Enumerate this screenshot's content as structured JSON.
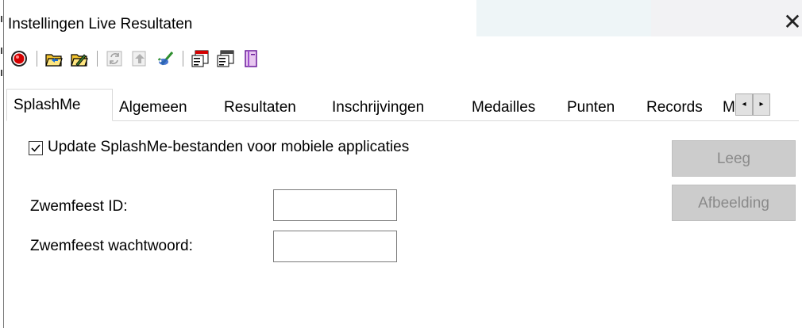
{
  "window": {
    "title": "Instellingen Live Resultaten",
    "close_glyph": "✕"
  },
  "toolbar": {
    "buttons": [
      {
        "icon": "record-icon"
      },
      {
        "icon": "open-folder-icon"
      },
      {
        "icon": "edit-folder-icon"
      },
      {
        "icon": "refresh-icon",
        "disabled": true
      },
      {
        "icon": "upload-icon",
        "disabled": true
      },
      {
        "icon": "check-connect-icon"
      },
      {
        "icon": "properties-red-icon"
      },
      {
        "icon": "properties-icon"
      },
      {
        "icon": "book-icon"
      }
    ]
  },
  "tabs": [
    {
      "label": "SplashMe",
      "selected": true
    },
    {
      "label": "Algemeen"
    },
    {
      "label": "Resultaten"
    },
    {
      "label": "Inschrijvingen"
    },
    {
      "label": "Medailles"
    },
    {
      "label": "Punten"
    },
    {
      "label": "Records"
    },
    {
      "label": "M"
    }
  ],
  "tab_scroll": {
    "left": "◂",
    "right": "▸"
  },
  "splashme": {
    "update_checkbox": {
      "label": "Update SplashMe-bestanden voor mobiele applicaties",
      "checked": true
    },
    "meet_id": {
      "label": "Zwemfeest ID:",
      "value": ""
    },
    "meet_password": {
      "label": "Zwemfeest wachtwoord:",
      "value": ""
    },
    "clear_button": {
      "label": "Leeg",
      "enabled": false
    },
    "image_button": {
      "label": "Afbeelding",
      "enabled": false
    }
  },
  "colors": {
    "disabled_button_bg": "#cccccc",
    "disabled_button_text": "#8a8a8a",
    "tab_border": "#d9d9d9"
  }
}
